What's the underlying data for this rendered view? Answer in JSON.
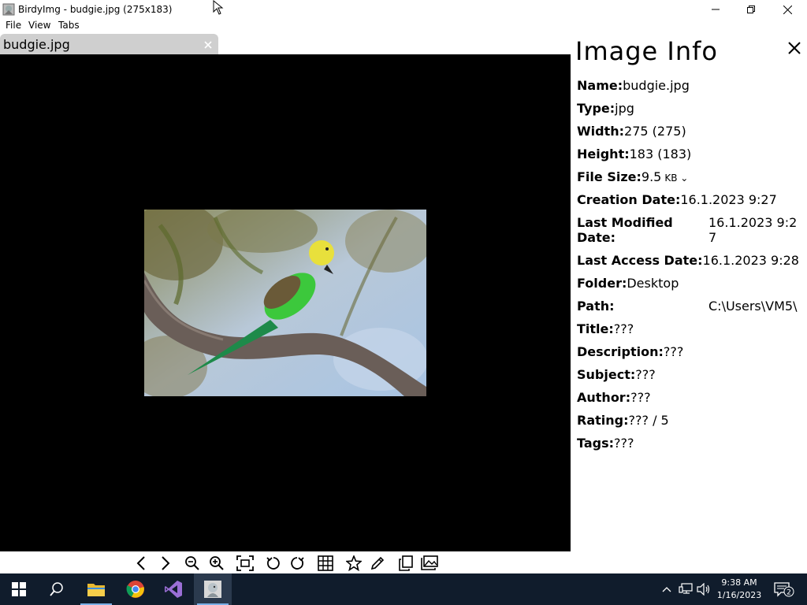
{
  "window": {
    "title": "BirdyImg - budgie.jpg (275x183)"
  },
  "menu": {
    "items": [
      "File",
      "View",
      "Tabs"
    ]
  },
  "tabs": [
    {
      "label": "budgie.jpg"
    }
  ],
  "info_panel": {
    "heading": "Image Info",
    "fields": {
      "name": {
        "label": "Name:",
        "value": "budgie.jpg"
      },
      "type": {
        "label": "Type:",
        "value": "jpg"
      },
      "width": {
        "label": "Width:",
        "value": "275 (275)"
      },
      "height": {
        "label": "Height:",
        "value": "183 (183)"
      },
      "file_size": {
        "label": "File Size:",
        "value": "9.5",
        "unit": "KB"
      },
      "creation_date": {
        "label": "Creation Date:",
        "value": "16.1.2023 9:27"
      },
      "last_modified": {
        "label_line1": "Last Modified",
        "label_line2": "Date:",
        "value_line1": "16.1.2023 9:2",
        "value_line2": "7"
      },
      "last_access": {
        "label": "Last Access Date:",
        "value": "16.1.2023 9:28"
      },
      "folder": {
        "label": "Folder:",
        "value": "Desktop"
      },
      "path": {
        "label": "Path:",
        "value": "C:\\Users\\VM5\\"
      },
      "title": {
        "label": "Title:",
        "value": "???"
      },
      "description": {
        "label": "Description:",
        "value": "???"
      },
      "subject": {
        "label": "Subject:",
        "value": "???"
      },
      "author": {
        "label": "Author:",
        "value": "???"
      },
      "rating": {
        "label": "Rating:",
        "value": "??? / 5"
      },
      "tags": {
        "label": "Tags:",
        "value": "???"
      }
    }
  },
  "toolbar": {
    "icons": [
      "chevron-left-icon",
      "chevron-right-icon",
      "zoom-out-icon",
      "zoom-in-icon",
      "fit-screen-icon",
      "rotate-left-icon",
      "rotate-right-icon",
      "grid-icon",
      "star-icon",
      "pencil-icon",
      "copy-icon",
      "images-icon"
    ]
  },
  "taskbar": {
    "time": "9:38 AM",
    "date": "1/16/2023",
    "notification_count": "2",
    "apps": [
      "start-icon",
      "search-icon",
      "file-explorer-icon",
      "chrome-icon",
      "visual-studio-icon",
      "birdyimg-icon"
    ]
  },
  "colors": {
    "viewer_bg": "#000000",
    "tab_bg": "#cfcfcf",
    "taskbar_bg": "#101c2c",
    "active_app_bar": "#7ab0e8"
  }
}
